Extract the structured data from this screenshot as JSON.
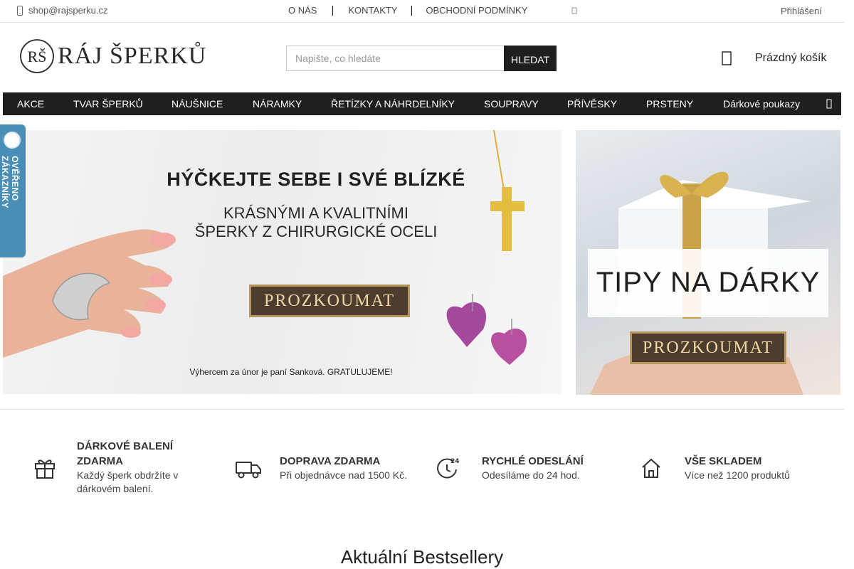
{
  "topbar": {
    "email": "shop@rajsperku.cz",
    "links": [
      "O NÁS",
      "KONTAKTY",
      "OBCHODNÍ PODMÍNKY"
    ],
    "login": "Přihlášení"
  },
  "header": {
    "logo_text": "RÁJ ŠPERKŮ",
    "logo_monogram": "RŠ",
    "search_placeholder": "Napište, co hledáte",
    "search_button": "HLEDAT",
    "cart_label": "Prázdný košík"
  },
  "nav": {
    "items": [
      "AKCE",
      "TVAR ŠPERKŮ",
      "NÁUŠNICE",
      "NÁRAMKY",
      "ŘETÍZKY A NÁHRDELNÍKY",
      "SOUPRAVY",
      "PŘÍVĚSKY",
      "PRSTENY",
      "Dárkové poukazy"
    ]
  },
  "badge": {
    "text": "OVĚŘENO ZÁKAZNÍKY"
  },
  "banner_main": {
    "headline": "HÝČKEJTE SEBE I SVÉ BLÍZKÉ",
    "subline1": "KRÁSNÝMI A KVALITNÍMI",
    "subline2": "ŠPERKY Z CHIRURGICKÉ OCELI",
    "button": "PROZKOUMAT",
    "footnote": "Výhercem za únor je paní Sanková. GRATULUJEME!"
  },
  "banner_side": {
    "title": "TIPY NA DÁRKY",
    "button": "PROZKOUMAT"
  },
  "features": [
    {
      "icon": "gift-icon",
      "title": "DÁRKOVÉ BALENÍ ZDARMA",
      "desc": "Každý šperk obdržíte v dárkovém balení."
    },
    {
      "icon": "truck-icon",
      "title": "DOPRAVA ZDARMA",
      "desc": "Při objednávce nad 1500 Kč."
    },
    {
      "icon": "clock-24-icon",
      "title": "RYCHLÉ ODESLÁNÍ",
      "desc": "Odesíláme do 24 hod."
    },
    {
      "icon": "house-icon",
      "title": "VŠE SKLADEM",
      "desc": "Více než 1200 produktů"
    }
  ],
  "section": {
    "title": "Aktuální Bestsellery"
  },
  "colors": {
    "nav_bg": "#1f1f1f",
    "badge_bg": "#4a8eb7",
    "button_gold": "#b8975c",
    "button_brown": "#4c3d2e"
  }
}
